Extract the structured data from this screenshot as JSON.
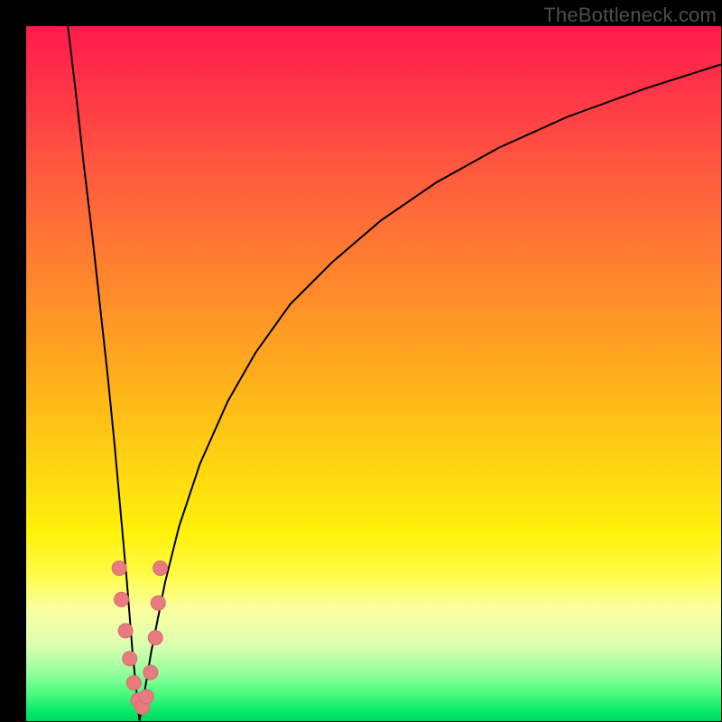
{
  "watermark": "TheBottleneck.com",
  "colors": {
    "curve_stroke": "#000000",
    "marker_fill": "#e77b80",
    "marker_stroke": "#d96a6f"
  },
  "chart_data": {
    "type": "line",
    "title": "",
    "xlabel": "",
    "ylabel": "",
    "xlim": [
      0,
      100
    ],
    "ylim": [
      0,
      100
    ],
    "grid": false,
    "annotations": [
      "TheBottleneck.com"
    ],
    "series": [
      {
        "name": "left-branch",
        "x": [
          6,
          7.2,
          8.3,
          9.5,
          10.6,
          11.7,
          12.7,
          13.6,
          14.5,
          15.3,
          16.0,
          16.3
        ],
        "values": [
          100,
          90,
          80,
          70,
          60,
          50,
          40,
          30,
          20,
          10,
          3,
          0
        ]
      },
      {
        "name": "right-branch",
        "x": [
          16.3,
          17,
          18,
          19,
          20,
          22,
          25,
          29,
          33,
          38,
          44,
          51,
          59,
          68,
          78,
          89,
          100
        ],
        "values": [
          0,
          4,
          10,
          15,
          20,
          28,
          37,
          46,
          53,
          60,
          66,
          72,
          77.5,
          82.5,
          87,
          91,
          94.5
        ]
      }
    ],
    "markers": {
      "name": "highlight-points",
      "x": [
        13.4,
        13.7,
        14.3,
        14.9,
        15.5,
        16.1,
        16.7,
        17.3,
        17.9,
        18.6,
        19.0,
        19.3
      ],
      "values": [
        22,
        17.5,
        13,
        9,
        5.5,
        3,
        2,
        3.5,
        7,
        12,
        17,
        22
      ]
    },
    "min_point": {
      "x": 16.3,
      "y": 0
    }
  }
}
